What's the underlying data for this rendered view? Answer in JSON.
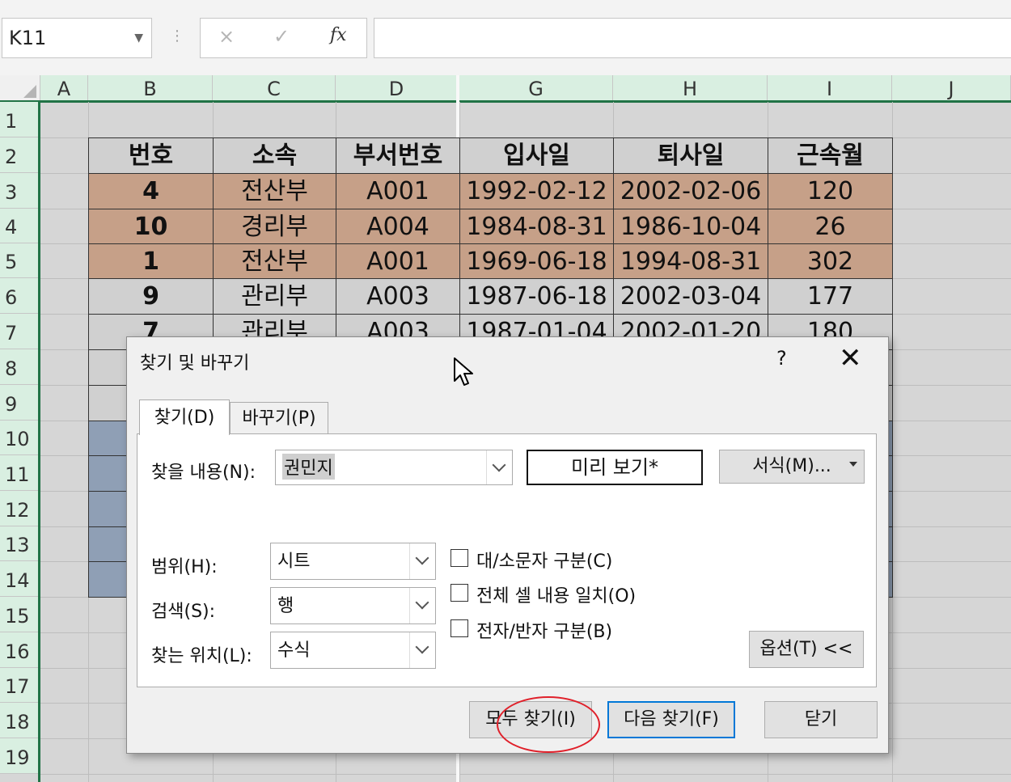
{
  "formula_bar": {
    "name_box": "K11",
    "cancel_icon": "×",
    "enter_icon": "✓",
    "function_icon": "fx",
    "formula": ""
  },
  "columns": [
    "A",
    "B",
    "C",
    "D",
    "G",
    "H",
    "I",
    "J"
  ],
  "rows": [
    "1",
    "2",
    "3",
    "4",
    "5",
    "6",
    "7",
    "8",
    "9",
    "10",
    "11",
    "12",
    "13",
    "14",
    "15",
    "16",
    "17",
    "18",
    "19"
  ],
  "table": {
    "headers": [
      "번호",
      "소속",
      "부서번호",
      "입사일",
      "퇴사일",
      "근속월"
    ],
    "rows": [
      [
        "4",
        "전산부",
        "A001",
        "1992-02-12",
        "2002-02-06",
        "120"
      ],
      [
        "10",
        "경리부",
        "A004",
        "1984-08-31",
        "1986-10-04",
        "26"
      ],
      [
        "1",
        "전산부",
        "A001",
        "1969-06-18",
        "1994-08-31",
        "302"
      ],
      [
        "9",
        "관리부",
        "A003",
        "1987-06-18",
        "2002-03-04",
        "177"
      ],
      [
        "7",
        "관리부",
        "A003",
        "1987-01-04",
        "2002-01-20",
        "180"
      ]
    ],
    "colors": {
      "header_fill": "#d0d0d0",
      "highlight_fill": "#c6a088",
      "plain_fill": "#d0d0d0",
      "selected_fill": "#8f9fb5"
    }
  },
  "dialog": {
    "title": "찾기 및 바꾸기",
    "help": "?",
    "close": "✕",
    "tabs": [
      {
        "label": "찾기(D)",
        "active": true
      },
      {
        "label": "바꾸기(P)",
        "active": false
      }
    ],
    "find_label": "찾을 내용(N):",
    "find_value": "권민지",
    "preview": "미리 보기*",
    "format_button": "서식(M)...",
    "scope_label": "범위(H):",
    "scope_value": "시트",
    "search_label": "검색(S):",
    "search_value": "행",
    "lookin_label": "찾는 위치(L):",
    "lookin_value": "수식",
    "checkboxes": [
      {
        "label": "대/소문자 구분(C)",
        "checked": false
      },
      {
        "label": "전체 셀 내용 일치(O)",
        "checked": false
      },
      {
        "label": "전자/반자 구분(B)",
        "checked": false
      }
    ],
    "options_button": "옵션(T) <<",
    "find_all_button": "모두 찾기(I)",
    "find_next_button": "다음 찾기(F)",
    "close_button": "닫기",
    "accent_color": "#0078d7",
    "annotation_color": "#e0202a"
  }
}
